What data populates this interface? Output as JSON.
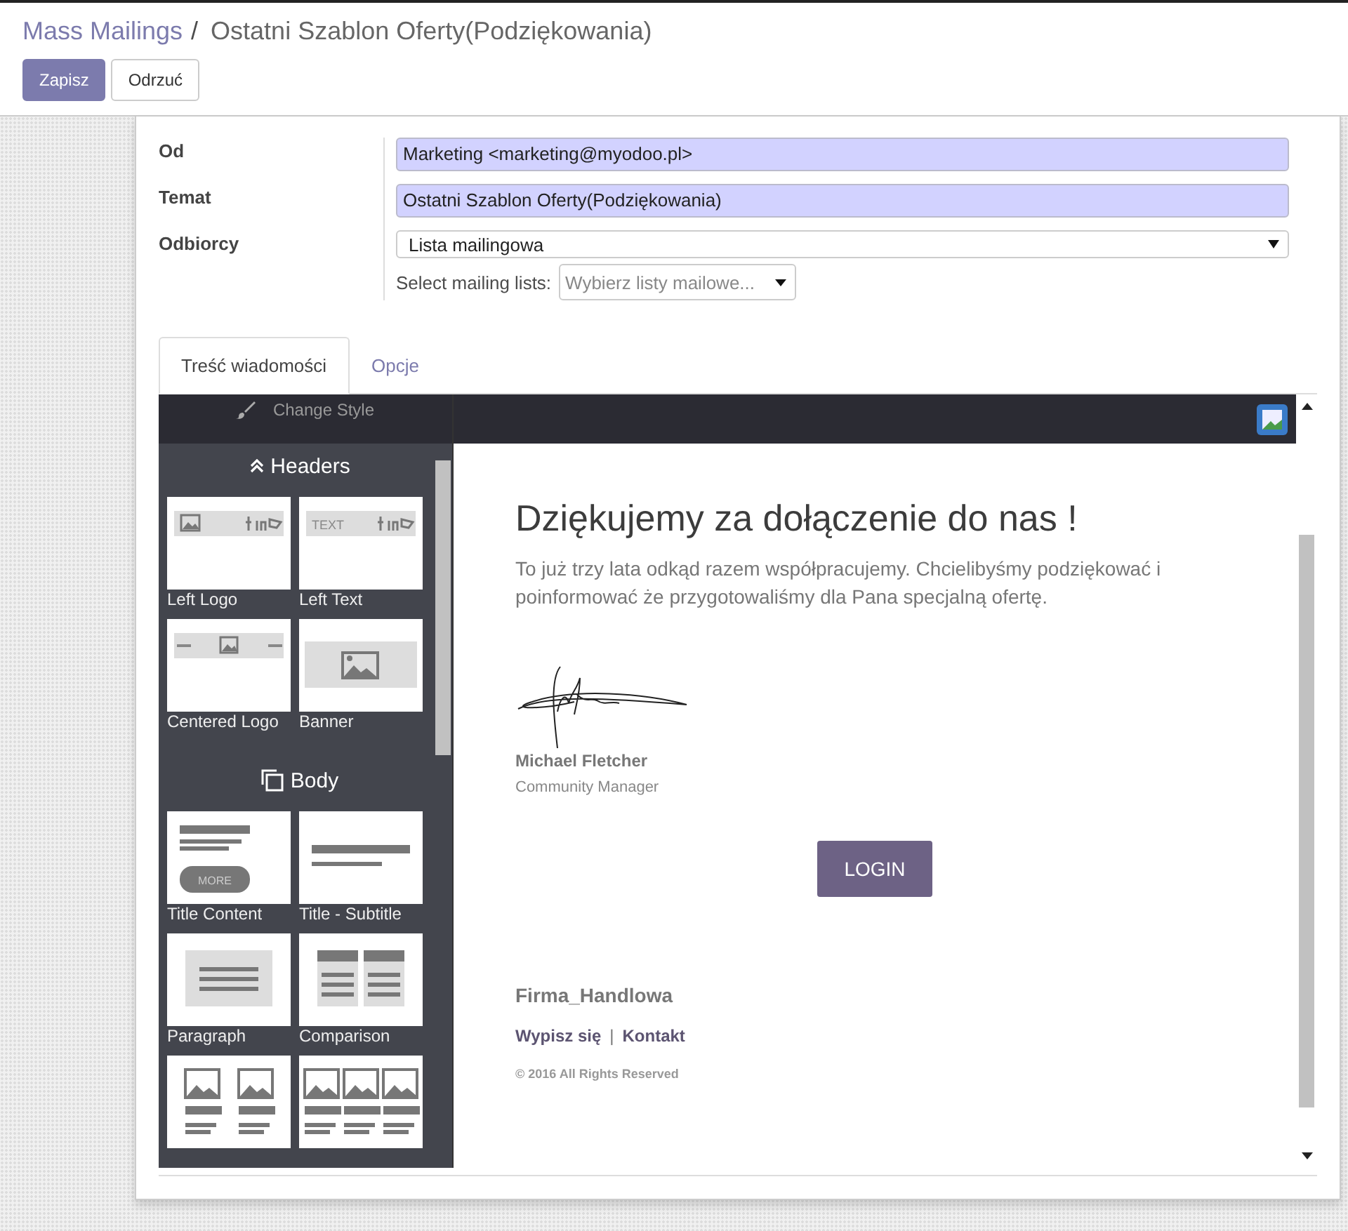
{
  "breadcrumb": {
    "parent": "Mass Mailings",
    "separator": "/",
    "current": "Ostatni Szablon Oferty(Podziękowania)"
  },
  "buttons": [
    {
      "label": "Zapisz",
      "kind": "primary"
    },
    {
      "label": "Odrzuć",
      "kind": "secondary"
    }
  ],
  "fields": [
    {
      "label": "Od",
      "kind": "input",
      "value": "Marketing <marketing@myodoo.pl>"
    },
    {
      "label": "Temat",
      "kind": "input",
      "value": "Ostatni Szablon Oferty(Podziękowania)"
    },
    {
      "label": "Odbiorcy",
      "kind": "select",
      "value": "Lista mailingowa"
    }
  ],
  "mailing_lists": {
    "label": "Select mailing lists:",
    "placeholder": "Wybierz listy mailowe..."
  },
  "tabs": [
    {
      "label": "Treść wiadomości",
      "selected": true
    },
    {
      "label": "Opcje",
      "selected": false
    }
  ],
  "editor": {
    "change_style": "Change Style",
    "sections": [
      {
        "title": "Headers",
        "rows": [
          [
            {
              "kind": "left-logo",
              "label": "Left Logo"
            },
            {
              "kind": "left-text",
              "label": "Left Text",
              "thumb_text": "TEXT"
            }
          ],
          [
            {
              "kind": "centered-logo",
              "label": "Centered Logo"
            },
            {
              "kind": "banner",
              "label": "Banner"
            }
          ]
        ]
      },
      {
        "title": "Body",
        "rows": [
          [
            {
              "kind": "title-content",
              "label": "Title Content",
              "thumb_text": "MORE"
            },
            {
              "kind": "title-subtitle",
              "label": "Title - Subtitle"
            }
          ],
          [
            {
              "kind": "paragraph",
              "label": "Paragraph"
            },
            {
              "kind": "comparison",
              "label": "Comparison"
            }
          ],
          [
            {
              "kind": "two-images"
            },
            {
              "kind": "three-images"
            }
          ]
        ]
      }
    ]
  },
  "email": {
    "heading": "Dziękujemy za dołączenie do nas !",
    "body": "To już trzy lata odkąd razem współpracujemy. Chcielibyśmy podziękować i poinformować że przygotowaliśmy dla Pana specjalną ofertę.",
    "signer": "Michael Fletcher",
    "role": "Community Manager",
    "button": "LOGIN",
    "company": "Firma_Handlowa",
    "links": [
      "Wypisz się",
      "Kontakt"
    ],
    "link_separator": "|",
    "copyright": "© 2016 All Rights Reserved"
  }
}
